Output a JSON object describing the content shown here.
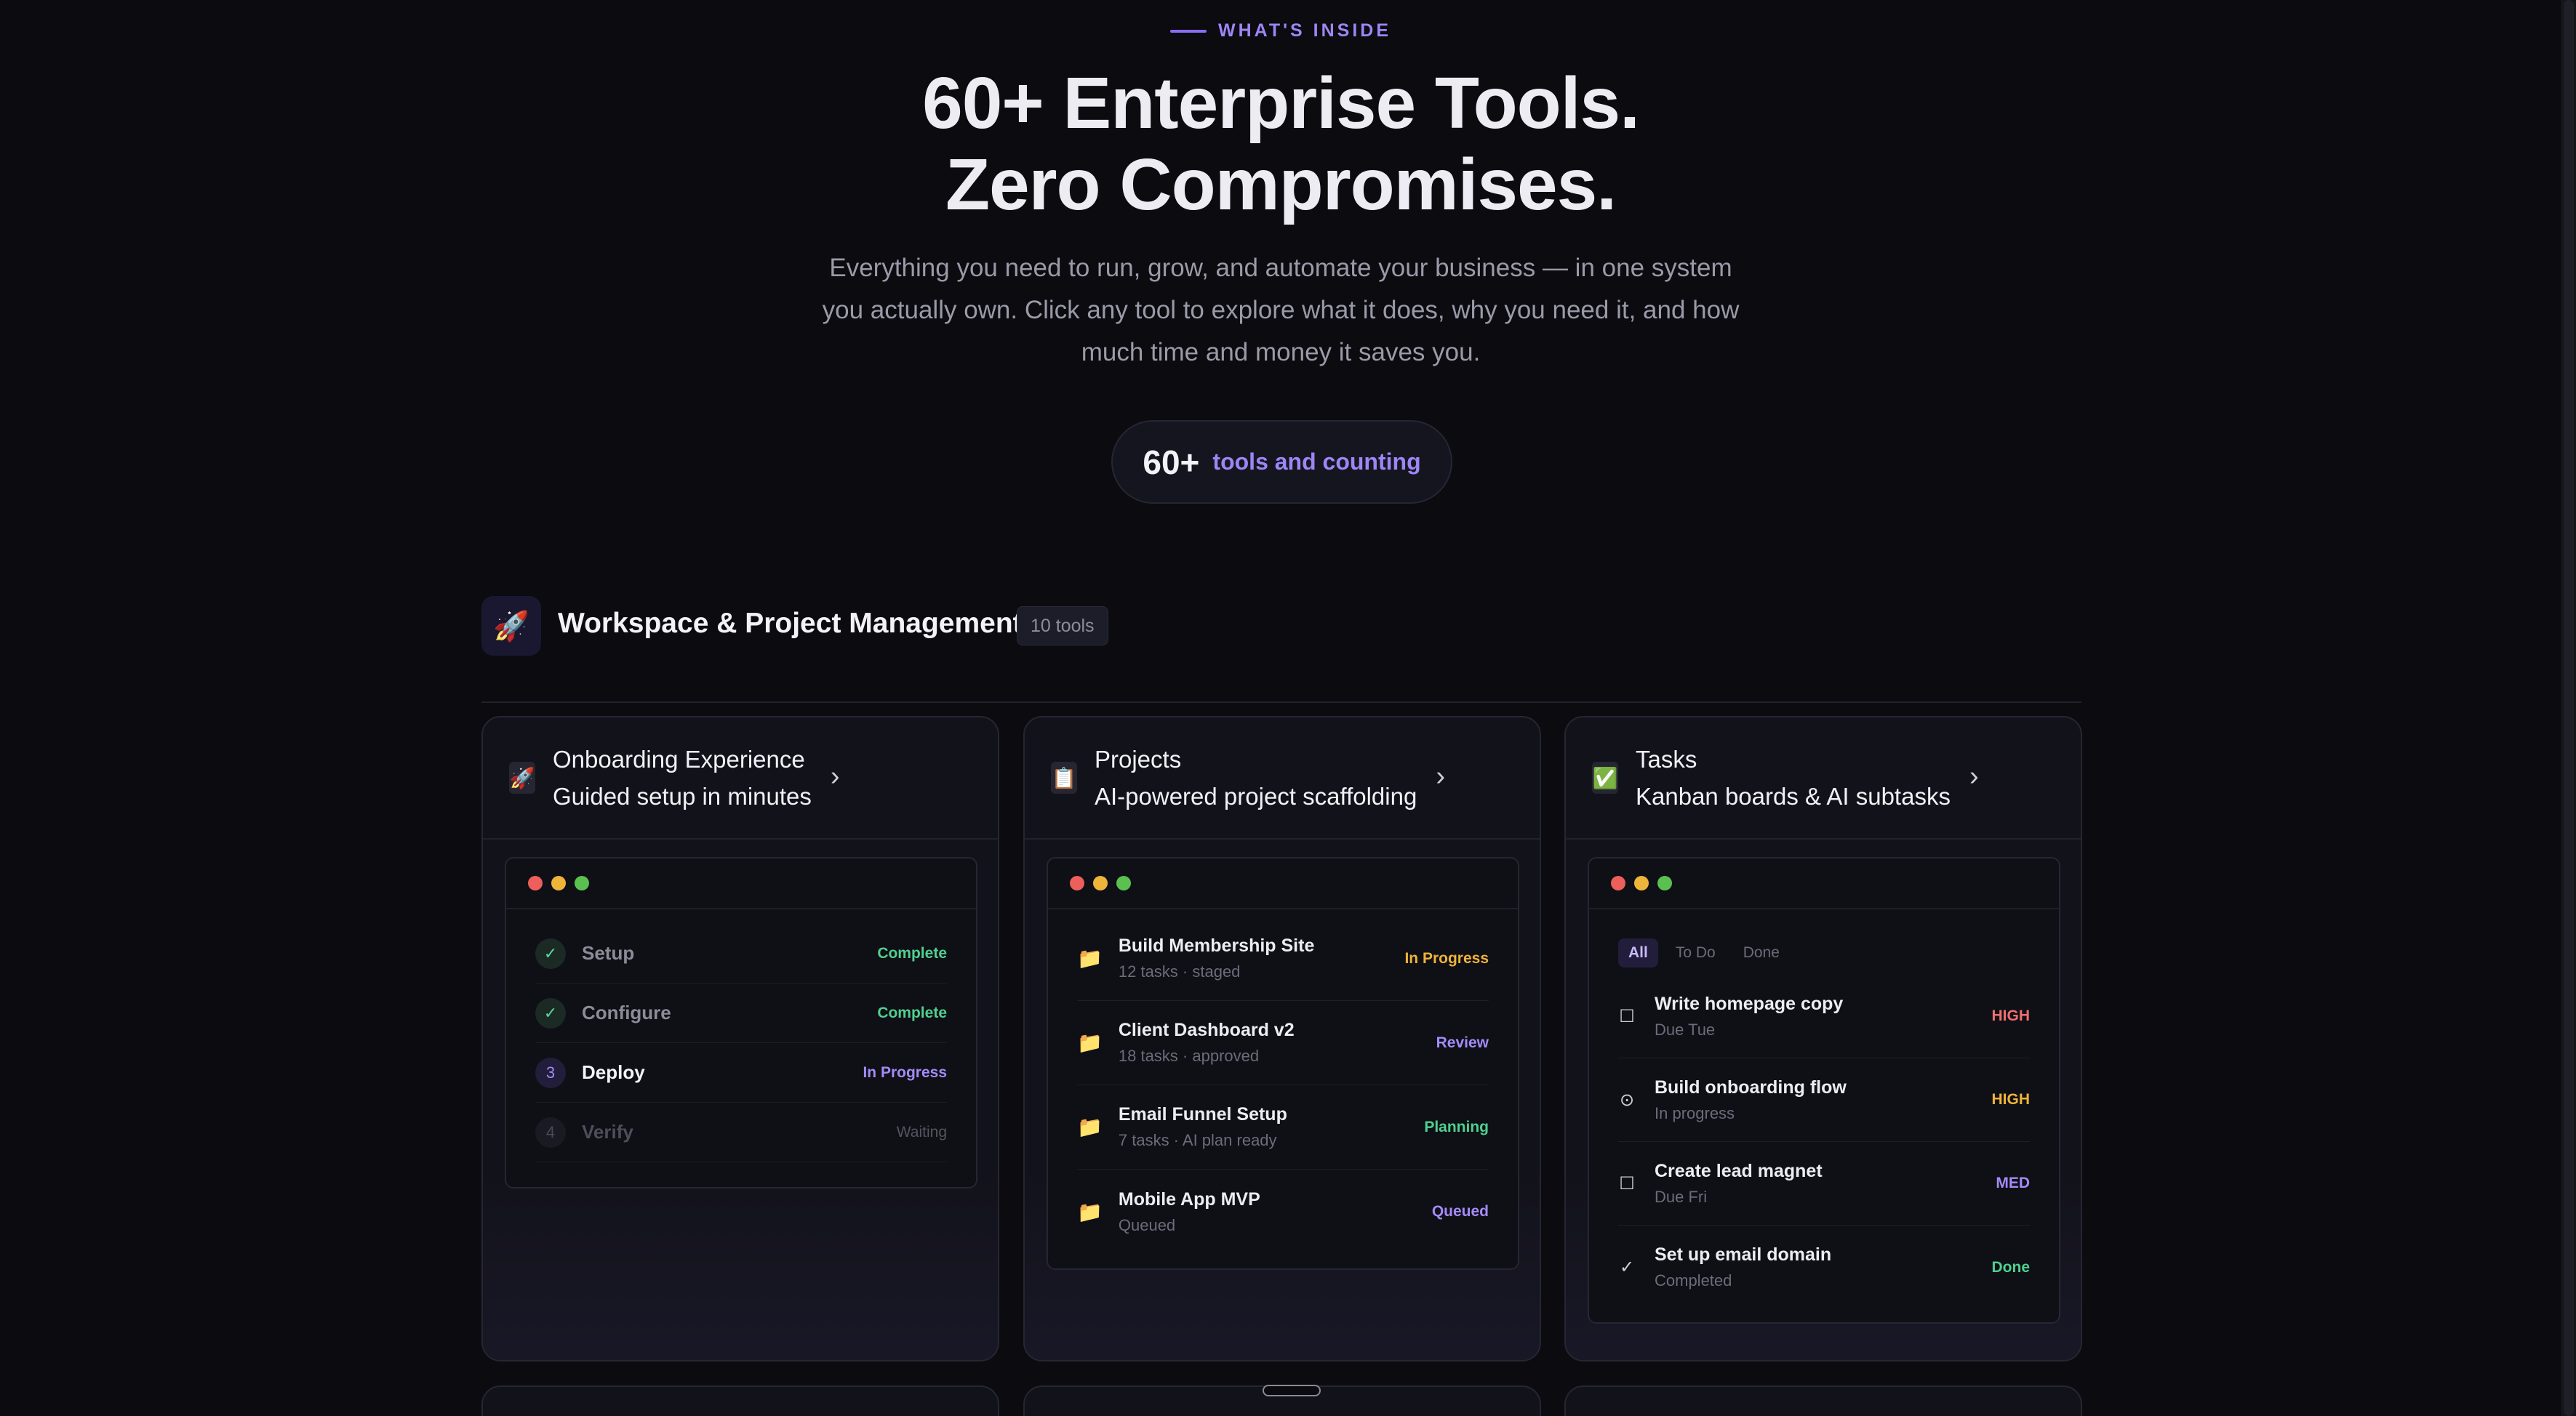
{
  "hero": {
    "eyebrow": "WHAT'S INSIDE",
    "title_line1": "60+ Enterprise Tools.",
    "title_line2": "Zero Compromises.",
    "description": "Everything you need to run, grow, and automate your business — in one system you actually own. Click any tool to explore what it does, why you need it, and how much time and money it saves you.",
    "counter_number": "60+",
    "counter_text": "tools and counting"
  },
  "section": {
    "icon": "rocket-icon",
    "title": "Workspace & Project Management",
    "badge": "10 tools"
  },
  "cards": [
    {
      "icon": "rocket-icon",
      "title": "Onboarding Experience",
      "subtitle": "Guided setup in minutes",
      "steps": [
        {
          "mark": "✓",
          "label": "Setup",
          "status": "Complete"
        },
        {
          "mark": "✓",
          "label": "Configure",
          "status": "Complete"
        },
        {
          "mark": "3",
          "label": "Deploy",
          "status": "In Progress"
        },
        {
          "mark": "4",
          "label": "Verify",
          "status": "Waiting"
        }
      ]
    },
    {
      "icon": "clipboard-icon",
      "title": "Projects",
      "subtitle": "AI-powered project scaffolding",
      "projects": [
        {
          "name": "Build Membership Site",
          "meta": "12 tasks · staged",
          "status": "In Progress"
        },
        {
          "name": "Client Dashboard v2",
          "meta": "18 tasks · approved",
          "status": "Review"
        },
        {
          "name": "Email Funnel Setup",
          "meta": "7 tasks · AI plan ready",
          "status": "Planning"
        },
        {
          "name": "Mobile App MVP",
          "meta": "Queued",
          "status": "Queued"
        }
      ]
    },
    {
      "icon": "checkbox-icon",
      "title": "Tasks",
      "subtitle": "Kanban boards & AI subtasks",
      "tabs": [
        "All",
        "To Do",
        "Done"
      ],
      "tasks": [
        {
          "mark": "☐",
          "name": "Write homepage copy",
          "meta": "Due Tue",
          "priority": "HIGH"
        },
        {
          "mark": "⊙",
          "name": "Build onboarding flow",
          "meta": "In progress",
          "priority": "HIGH"
        },
        {
          "mark": "☐",
          "name": "Create lead magnet",
          "meta": "Due Fri",
          "priority": "MED"
        },
        {
          "mark": "✓",
          "name": "Set up email domain",
          "meta": "Completed",
          "priority": "Done"
        }
      ]
    }
  ],
  "colors": {
    "accent": "#9d86f5",
    "background": "#0b0b10",
    "green": "#4fd08f",
    "orange": "#efb43a",
    "red": "#ee6f6f"
  }
}
